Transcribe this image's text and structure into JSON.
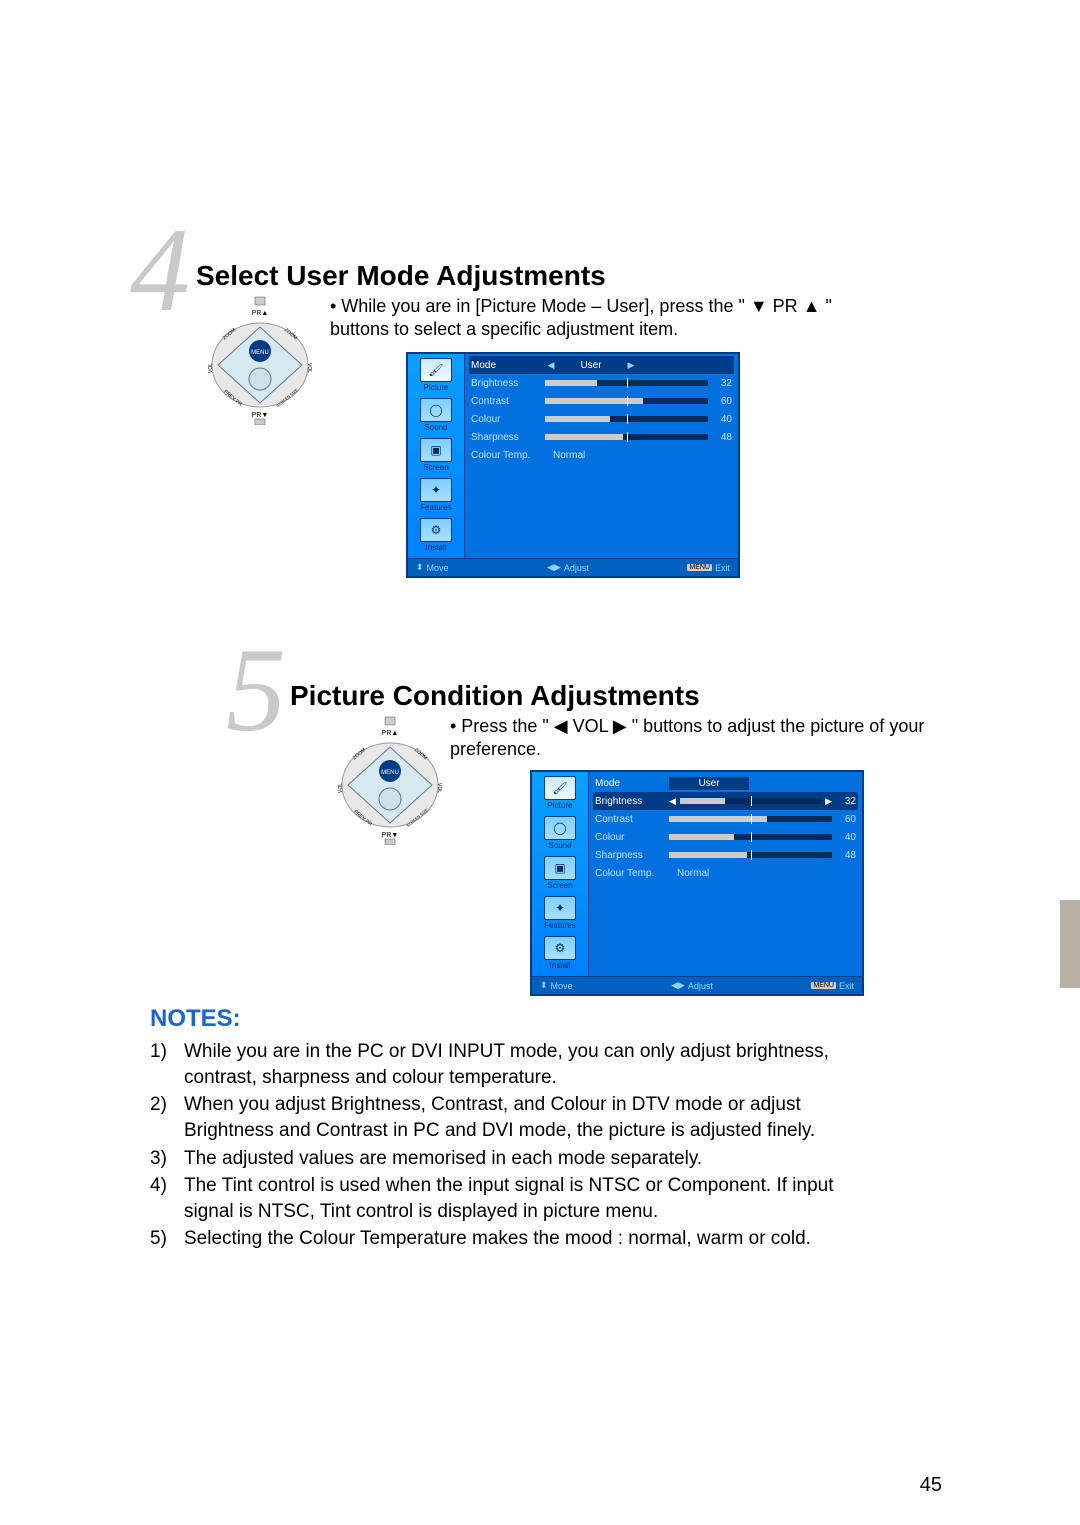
{
  "page_number": "45",
  "step4": {
    "number": "4",
    "title": "Select User Mode Adjustments",
    "bullet": "• While you are in [Picture Mode – User], press the \" ▼ PR ▲ \" buttons to select  a specific adjustment item."
  },
  "step5": {
    "number": "5",
    "title": "Picture Condition Adjustments",
    "bullet": "• Press the \" ◀ VOL ▶ \" buttons to adjust the picture of your preference."
  },
  "osd": {
    "side": [
      {
        "label": "Picture",
        "glyph": "🖌"
      },
      {
        "label": "Sound",
        "glyph": "◯"
      },
      {
        "label": "Screen",
        "glyph": "▣"
      },
      {
        "label": "Features",
        "glyph": "✦"
      },
      {
        "label": "Install",
        "glyph": "⚙"
      }
    ],
    "rows": {
      "mode_label": "Mode",
      "mode_value": "User",
      "brightness_label": "Brightness",
      "brightness_value": "32",
      "contrast_label": "Contrast",
      "contrast_value": "60",
      "colour_label": "Colour",
      "colour_value": "40",
      "sharpness_label": "Sharpness",
      "sharpness_value": "48",
      "ctemp_label": "Colour Temp.",
      "ctemp_value": "Normal"
    },
    "foot": {
      "move": "Move",
      "adjust": "Adjust",
      "menu": "MENU",
      "exit": "Exit"
    }
  },
  "remote": {
    "pr_up": "PR▲",
    "pr_dn": "PR▼",
    "vol": "VOL",
    "zoom": "ZOOM",
    "menu": "MENU",
    "prev_pr": "PREV PR",
    "screen_size": "SCREEN SIZE"
  },
  "notes": {
    "heading": "NOTES:",
    "items": [
      {
        "num": "1)",
        "text": "While you are in the PC or DVI INPUT mode, you can only adjust brightness, contrast, sharpness and colour temperature."
      },
      {
        "num": "2)",
        "text": "When you adjust Brightness, Contrast, and Colour in DTV mode or adjust Brightness and Contrast in PC and DVI mode, the picture is adjusted finely."
      },
      {
        "num": "3)",
        "text": "The adjusted values are memorised in each mode separately."
      },
      {
        "num": "4)",
        "text": "The Tint control is used when the input signal is NTSC or Component. If input signal is NTSC, Tint control is displayed in picture menu."
      },
      {
        "num": "5)",
        "text": "Selecting the Colour Temperature makes the mood : normal, warm or cold."
      }
    ]
  }
}
